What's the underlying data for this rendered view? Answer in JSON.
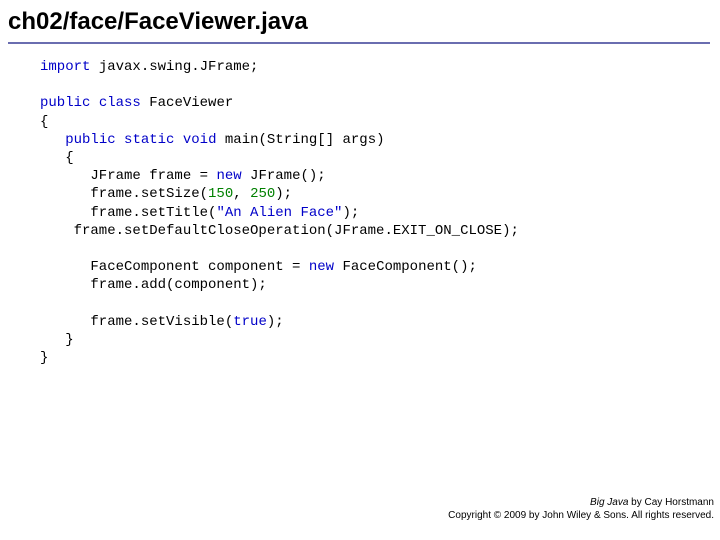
{
  "title": "ch02/face/FaceViewer.java",
  "code": {
    "kw_import": "import",
    "import_rest": " javax.swing.JFrame;",
    "kw_public1": "public",
    "kw_class": "class",
    "classname": " FaceViewer",
    "brace_open": "{",
    "kw_public2": "public",
    "kw_static": "static",
    "kw_void": "void",
    "main_sig": " main(String[] args)",
    "brace_open2": "{",
    "line_frame1a": "      JFrame frame = ",
    "kw_new1": "new",
    "line_frame1b": " JFrame();",
    "line_setsize_a": "      frame.setSize(",
    "num150": "150",
    "comma_sp": ", ",
    "num250": "250",
    "line_setsize_b": ");",
    "line_title_a": "      frame.setTitle(",
    "str_title": "\"An Alien Face\"",
    "line_title_b": ");",
    "line_close": "    frame.setDefaultCloseOperation(JFrame.EXIT_ON_CLOSE);",
    "blank": "",
    "line_comp_a": "      FaceComponent component = ",
    "kw_new2": "new",
    "line_comp_b": " FaceComponent();",
    "line_add": "      frame.add(component);",
    "line_visible_a": "      frame.setVisible(",
    "kw_true": "true",
    "line_visible_b": ");",
    "brace_close2": "   }",
    "brace_close": "}"
  },
  "footer": {
    "line1a": "Big Java",
    "line1b": " by Cay Horstmann",
    "line2": "Copyright © 2009 by John Wiley & Sons. All rights reserved."
  }
}
